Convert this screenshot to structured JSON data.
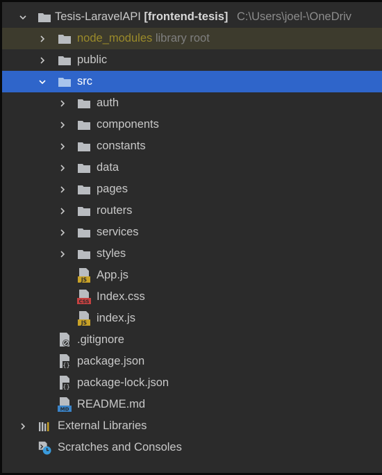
{
  "project": {
    "name": "Tesis-LaravelAPI",
    "module": "[frontend-tesis]",
    "path": "C:\\Users\\joel-\\OneDriv"
  },
  "tree": {
    "node_modules": {
      "name": "node_modules",
      "tag": "library root"
    },
    "public": "public",
    "src": "src",
    "src_folders": [
      "auth",
      "components",
      "constants",
      "data",
      "pages",
      "routers",
      "services",
      "styles"
    ],
    "src_files": [
      {
        "name": "App.js",
        "type": "JS"
      },
      {
        "name": "Index.css",
        "type": "CSS"
      },
      {
        "name": "index.js",
        "type": "JS"
      }
    ],
    "root_files": [
      {
        "name": ".gitignore",
        "icon": "gitignore-file-icon"
      },
      {
        "name": "package.json",
        "icon": "json-file-icon"
      },
      {
        "name": "package-lock.json",
        "icon": "json-file-icon"
      },
      {
        "name": "README.md",
        "icon": "markdown-file-icon"
      }
    ],
    "external_libraries": "External Libraries",
    "scratches": "Scratches and Consoles"
  },
  "colors": {
    "background": "#2b2b2b",
    "selection": "#2f65ca",
    "folder": "#b9bcc0",
    "js_badge": "#c9a227",
    "css_badge": "#c64141",
    "md_badge": "#3a84c9"
  }
}
